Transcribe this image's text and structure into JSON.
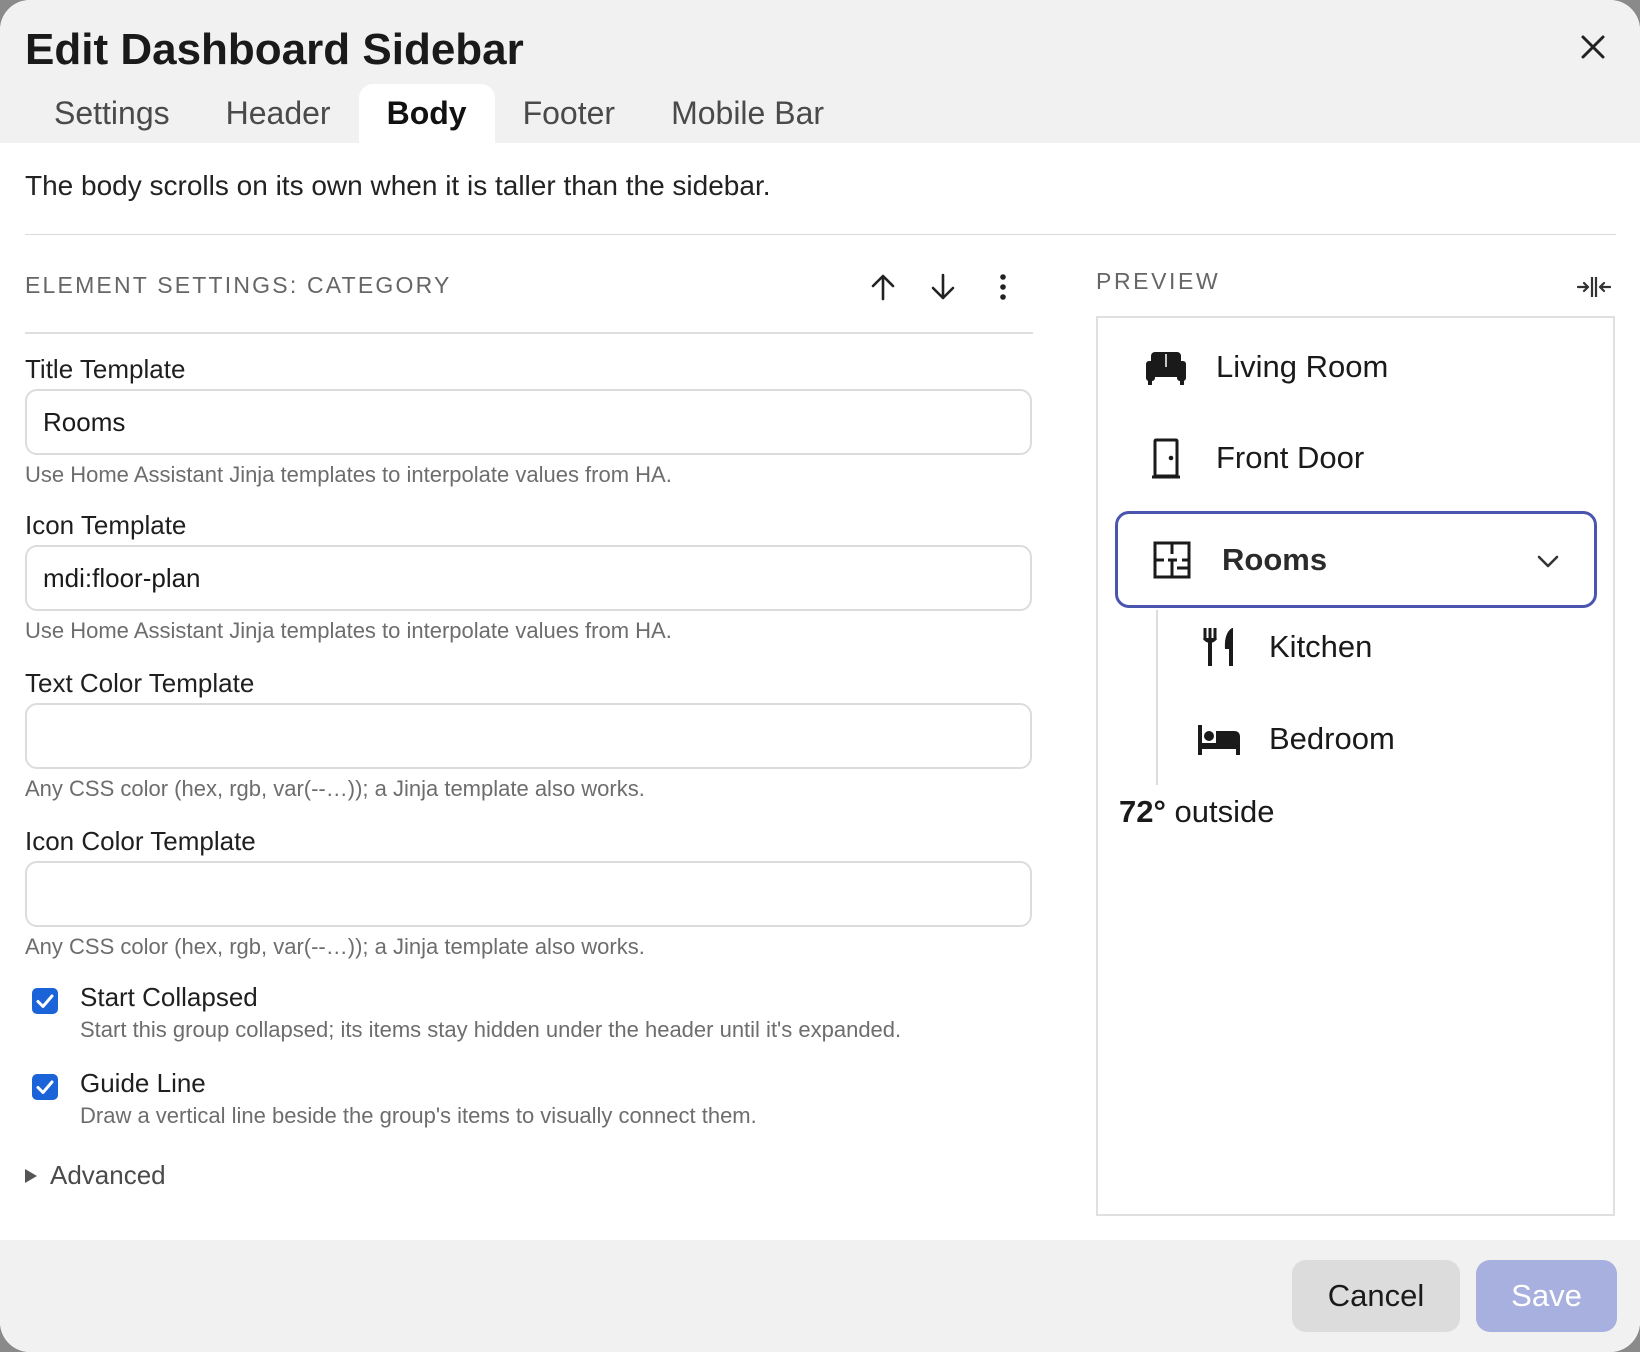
{
  "dialog": {
    "title": "Edit Dashboard Sidebar",
    "tabs": [
      {
        "label": "Settings",
        "active": false
      },
      {
        "label": "Header",
        "active": false
      },
      {
        "label": "Body",
        "active": true
      },
      {
        "label": "Footer",
        "active": false
      },
      {
        "label": "Mobile Bar",
        "active": false
      }
    ],
    "intro": "The body scrolls on its own when it is taller than the sidebar."
  },
  "settings": {
    "section_title": "ELEMENT SETTINGS: CATEGORY",
    "fields": [
      {
        "label": "Title Template",
        "value": "Rooms",
        "help": "Use Home Assistant Jinja templates to interpolate values from HA."
      },
      {
        "label": "Icon Template",
        "value": "mdi:floor-plan",
        "help": "Use Home Assistant Jinja templates to interpolate values from HA."
      },
      {
        "label": "Text Color Template",
        "value": "",
        "help": "Any CSS color (hex, rgb, var(--…)); a Jinja template also works."
      },
      {
        "label": "Icon Color Template",
        "value": "",
        "help": "Any CSS color (hex, rgb, var(--…)); a Jinja template also works."
      }
    ],
    "checkboxes": [
      {
        "label": "Start Collapsed",
        "checked": true,
        "help": "Start this group collapsed; its items stay hidden under the header until it's expanded."
      },
      {
        "label": "Guide Line",
        "checked": true,
        "help": "Draw a vertical line beside the group's items to visually connect them."
      }
    ],
    "advanced_label": "Advanced"
  },
  "preview": {
    "title": "PREVIEW",
    "items": [
      {
        "label": "Living Room",
        "icon": "sofa-icon"
      },
      {
        "label": "Front Door",
        "icon": "door-icon"
      }
    ],
    "group": {
      "label": "Rooms",
      "icon": "floor-plan-icon"
    },
    "subitems": [
      {
        "label": "Kitchen",
        "icon": "silverware-icon"
      },
      {
        "label": "Bedroom",
        "icon": "bed-icon"
      }
    ],
    "footer_bold": "72°",
    "footer_text": " outside"
  },
  "footer": {
    "cancel_label": "Cancel",
    "save_label": "Save"
  },
  "colors": {
    "accent": "#1a63d8",
    "group_border": "#4a55b0",
    "save_disabled": "#a8b0e0"
  }
}
